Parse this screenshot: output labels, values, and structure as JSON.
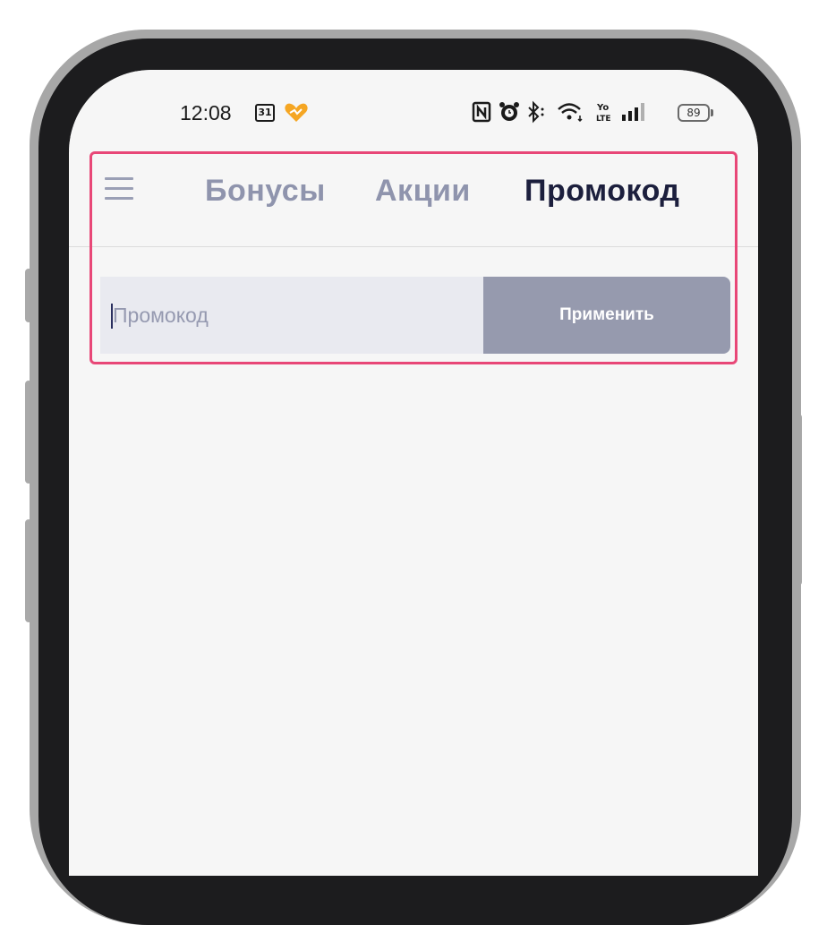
{
  "status_bar": {
    "time": "12:08",
    "calendar_day": "31",
    "battery": "89",
    "icons": [
      "calendar-icon",
      "heart-icon",
      "nfc-icon",
      "alarm-icon",
      "bluetooth-icon",
      "wifi-icon",
      "volte-icon",
      "signal-icon",
      "battery-icon"
    ]
  },
  "header": {
    "menu_icon": "hamburger-menu-icon",
    "tabs": [
      {
        "label": "Бонусы",
        "active": false
      },
      {
        "label": "Акции",
        "active": false
      },
      {
        "label": "Промокод",
        "active": true
      }
    ]
  },
  "promo": {
    "placeholder": "Промокод",
    "value": "",
    "apply_label": "Применить"
  },
  "colors": {
    "accent_highlight": "#e84777",
    "tab_active": "#1c1f3d",
    "tab_inactive": "#8f94ad",
    "button_bg": "#969aae",
    "input_bg": "#e9eaf0"
  }
}
